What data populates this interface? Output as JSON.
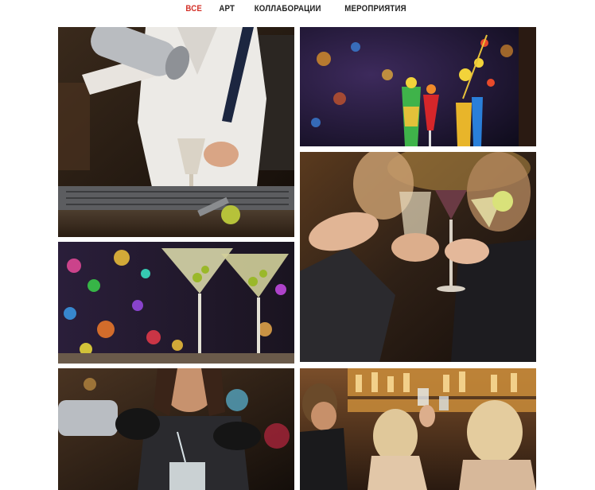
{
  "filters": {
    "tabs": [
      {
        "label": "ВСЕ",
        "active": true
      },
      {
        "label": "АРТ",
        "active": false
      },
      {
        "label": "КОЛЛАБОРАЦИИ",
        "active": false
      },
      {
        "label": "МЕРОПРИЯТИЯ",
        "active": false
      }
    ],
    "active_color": "#d4332b"
  },
  "gallery": {
    "items": [
      {
        "subject": "bartender shaking cocktail"
      },
      {
        "subject": "colorful cocktails with fruit garnish"
      },
      {
        "subject": "women toasting cocktails"
      },
      {
        "subject": "martini glasses with olives"
      },
      {
        "subject": "bartender pouring cocktail"
      },
      {
        "subject": "group of friends at bar"
      }
    ]
  }
}
